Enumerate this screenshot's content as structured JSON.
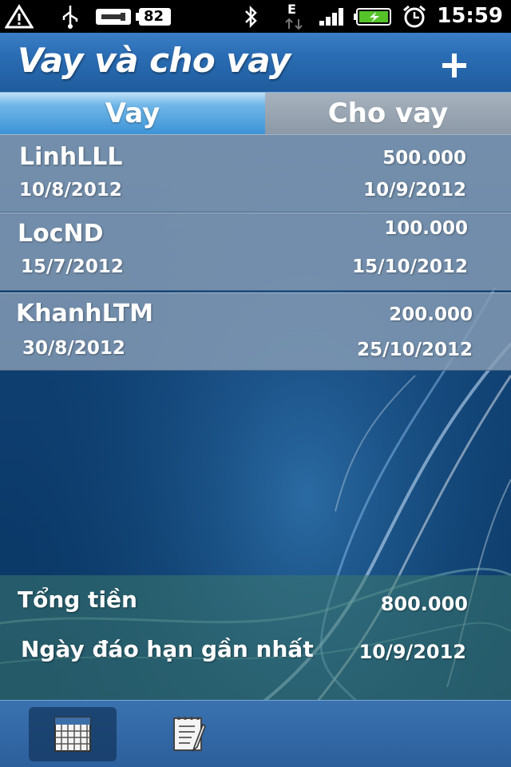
{
  "status_bar": {
    "battery": "82",
    "time": "15:59",
    "network": "E",
    "icons": [
      "warning-icon",
      "usb-icon",
      "usb-debug-icon",
      "battery-icon",
      "bluetooth-icon",
      "network-e-icon",
      "signal-icon",
      "charging-battery-icon",
      "alarm-icon"
    ]
  },
  "header": {
    "title": "Vay và cho vay",
    "add_icon": "plus-icon"
  },
  "tabs": [
    {
      "label": "Vay",
      "active": true
    },
    {
      "label": "Cho vay",
      "active": false
    }
  ],
  "loans": [
    {
      "name": "LinhLLL",
      "amount": "500.000",
      "date_from": "10/8/2012",
      "date_to": "10/9/2012"
    },
    {
      "name": "LocND",
      "amount": "100.000",
      "date_from": "15/7/2012",
      "date_to": "15/10/2012"
    },
    {
      "name": "KhanhLTM",
      "amount": "200.000",
      "date_from": "30/8/2012",
      "date_to": "25/10/2012"
    }
  ],
  "summary": {
    "total_label": "Tổng tiền",
    "total_value": "800.000",
    "nearest_due_label": "Ngày đáo hạn gần nhất",
    "nearest_due_value": "10/9/2012"
  },
  "bottom_bar": {
    "items": [
      {
        "icon": "calendar-icon",
        "active": true
      },
      {
        "icon": "notes-icon",
        "active": false
      }
    ]
  },
  "colors": {
    "title_bar": "#2a6cb3",
    "tab_active": "#3d93d6",
    "tab_inactive": "#8c99a6",
    "list_item": "#879eb6",
    "background": "#0f3f72"
  }
}
